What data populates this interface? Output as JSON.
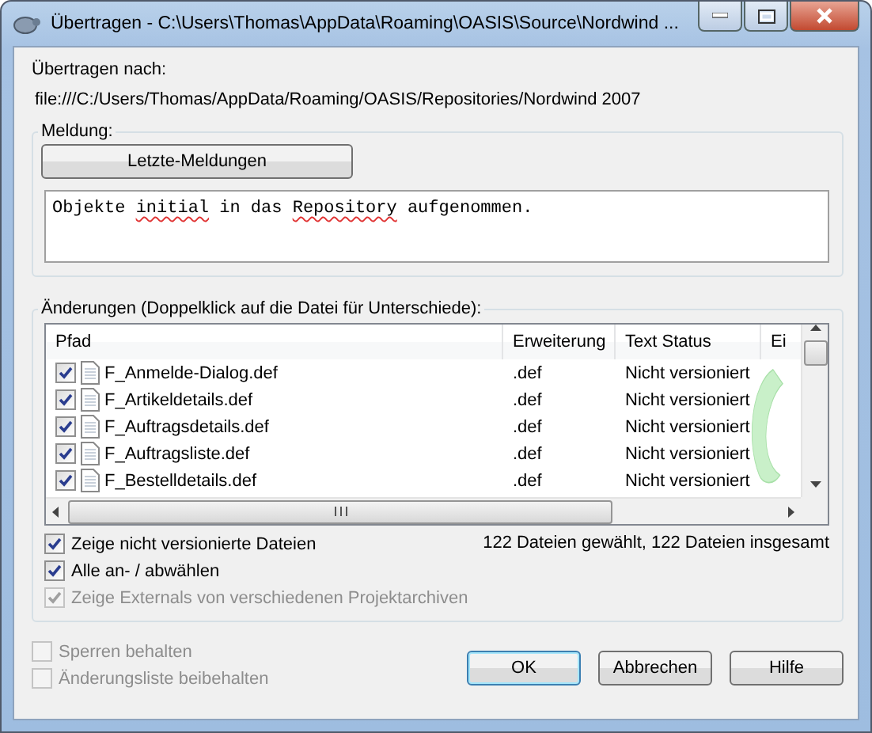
{
  "window": {
    "title": "Übertragen - C:\\Users\\Thomas\\AppData\\Roaming\\OASIS\\Source\\Nordwind ..."
  },
  "target": {
    "label": "Übertragen nach:",
    "url": "file:///C:/Users/Thomas/AppData/Roaming/OASIS/Repositories/Nordwind 2007"
  },
  "message": {
    "legend": "Meldung:",
    "recent_button": "Letzte-Meldungen",
    "segments": [
      {
        "text": "Objekte ",
        "misspelled": false
      },
      {
        "text": "initial",
        "misspelled": true
      },
      {
        "text": " in das ",
        "misspelled": false
      },
      {
        "text": "Repository",
        "misspelled": true
      },
      {
        "text": " aufgenommen.",
        "misspelled": false
      }
    ]
  },
  "changes": {
    "legend": "Änderungen (Doppelklick auf die Datei für Unterschiede):",
    "table": {
      "columns": [
        "Pfad",
        "Erweiterung",
        "Text Status",
        "Ei"
      ],
      "rows": [
        {
          "checked": true,
          "path": "F_Anmelde-Dialog.def",
          "extension": ".def",
          "status": "Nicht versioniert"
        },
        {
          "checked": true,
          "path": "F_Artikeldetails.def",
          "extension": ".def",
          "status": "Nicht versioniert"
        },
        {
          "checked": true,
          "path": "F_Auftragsdetails.def",
          "extension": ".def",
          "status": "Nicht versioniert"
        },
        {
          "checked": true,
          "path": "F_Auftragsliste.def",
          "extension": ".def",
          "status": "Nicht versioniert"
        },
        {
          "checked": true,
          "path": "F_Bestelldetails.def",
          "extension": ".def",
          "status": "Nicht versioniert"
        }
      ]
    },
    "summary": "122 Dateien gewählt, 122 Dateien insgesamt",
    "options": [
      {
        "label": "Zeige nicht versionierte Dateien",
        "checked": true,
        "disabled": false
      },
      {
        "label": "Alle an- / abwählen",
        "checked": true,
        "disabled": false
      },
      {
        "label": "Zeige Externals von verschiedenen Projektarchiven",
        "checked": true,
        "disabled": true
      }
    ]
  },
  "bottom_options": [
    {
      "label": "Sperren behalten",
      "checked": false,
      "disabled": true
    },
    {
      "label": "Änderungsliste beibehalten",
      "checked": false,
      "disabled": true
    }
  ],
  "buttons": [
    {
      "label": "OK",
      "default": true
    },
    {
      "label": "Abbrechen",
      "default": false
    },
    {
      "label": "Hilfe",
      "default": false
    }
  ]
}
